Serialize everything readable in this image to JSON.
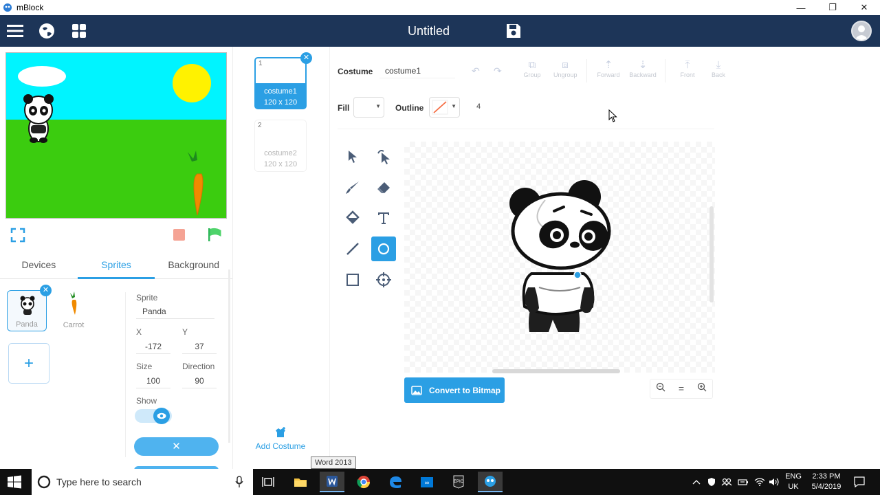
{
  "window": {
    "title": "mBlock",
    "minimize": "—",
    "restore": "❐",
    "close": "✕"
  },
  "header": {
    "title": "Untitled"
  },
  "stage_controls": {},
  "tabs": [
    {
      "label": "Devices"
    },
    {
      "label": "Sprites"
    },
    {
      "label": "Background"
    }
  ],
  "sprites": [
    {
      "name": "Panda"
    },
    {
      "name": "Carrot"
    }
  ],
  "add_sprite": "+",
  "props": {
    "sprite_label": "Sprite",
    "sprite_value": "Panda",
    "x_label": "X",
    "x_value": "-172",
    "y_label": "Y",
    "y_value": "37",
    "size_label": "Size",
    "size_value": "100",
    "direction_label": "Direction",
    "direction_value": "90",
    "show_label": "Show"
  },
  "costumes": [
    {
      "num": "1",
      "name": "costume1",
      "size": "120 x 120"
    },
    {
      "num": "2",
      "name": "costume2",
      "size": "120 x 120"
    }
  ],
  "add_costume": "Add Costume",
  "editor": {
    "costume_label": "Costume",
    "costume_name": "costume1",
    "fill_label": "Fill",
    "outline_label": "Outline",
    "outline_width": "4",
    "group": "Group",
    "ungroup": "Ungroup",
    "forward": "Forward",
    "backward": "Backward",
    "front": "Front",
    "back": "Back",
    "convert_button": "Convert to Bitmap",
    "zoom_reset": "="
  },
  "tooltip": "Word 2013",
  "taskbar": {
    "search_placeholder": "Type here to search",
    "lang": "ENG",
    "region": "UK",
    "time": "2:33 PM",
    "date": "5/4/2019"
  },
  "colors": {
    "header": "#1d3558",
    "accent": "#2b9fe4",
    "stage_sky": "#00f4ff",
    "stage_grass": "#3bcc0f"
  }
}
